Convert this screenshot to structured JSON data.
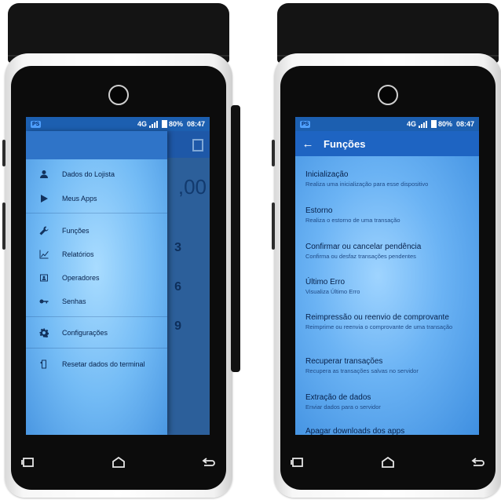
{
  "status_bar": {
    "app_badge": "PS",
    "network": "4G",
    "battery": "80%",
    "time": "08:47"
  },
  "left_screen": {
    "underlay": {
      "amount": ",00",
      "keys": [
        "3",
        "6",
        "9"
      ]
    },
    "drawer_items": [
      {
        "label": "Dados do Lojista",
        "icon": "person-icon"
      },
      {
        "label": "Meus Apps",
        "icon": "play-icon"
      },
      {
        "label": "Funções",
        "icon": "wrench-icon"
      },
      {
        "label": "Relatórios",
        "icon": "chart-icon"
      },
      {
        "label": "Operadores",
        "icon": "id-card-icon"
      },
      {
        "label": "Senhas",
        "icon": "key-icon"
      },
      {
        "label": "Configurações",
        "icon": "gear-icon"
      },
      {
        "label": "Resetar dados do terminal",
        "icon": "reset-device-icon"
      }
    ]
  },
  "right_screen": {
    "toolbar": {
      "back_icon": "arrow-back-icon",
      "title": "Funções"
    },
    "items": [
      {
        "title": "Inicialização",
        "desc": "Realiza uma inicialização para esse dispositivo"
      },
      {
        "title": "Estorno",
        "desc": "Realiza o estorno de uma transação"
      },
      {
        "title": "Confirmar ou cancelar pendência",
        "desc": "Confirma ou desfaz transações pendentes"
      },
      {
        "title": "Último Erro",
        "desc": "Visualiza Último Erro"
      },
      {
        "title": "Reimpressão ou reenvio de comprovante",
        "desc": "Reimprime ou reenvia o comprovante de uma transação"
      },
      {
        "title": "Recuperar transações",
        "desc": "Recupera as transações salvas no servidor"
      },
      {
        "title": "Extração de dados",
        "desc": "Enviar dados para o servidor"
      },
      {
        "title": "Apagar downloads dos apps",
        "desc": ""
      }
    ]
  },
  "nav_buttons": [
    "recent-apps-icon",
    "home-icon",
    "back-icon"
  ],
  "colors": {
    "screen_blue": "#6bb3f4",
    "toolbar_blue": "#1e64c2",
    "status_bar": "#1c5fb0",
    "device_shell": "#f5f5f5",
    "device_top": "#141414"
  }
}
